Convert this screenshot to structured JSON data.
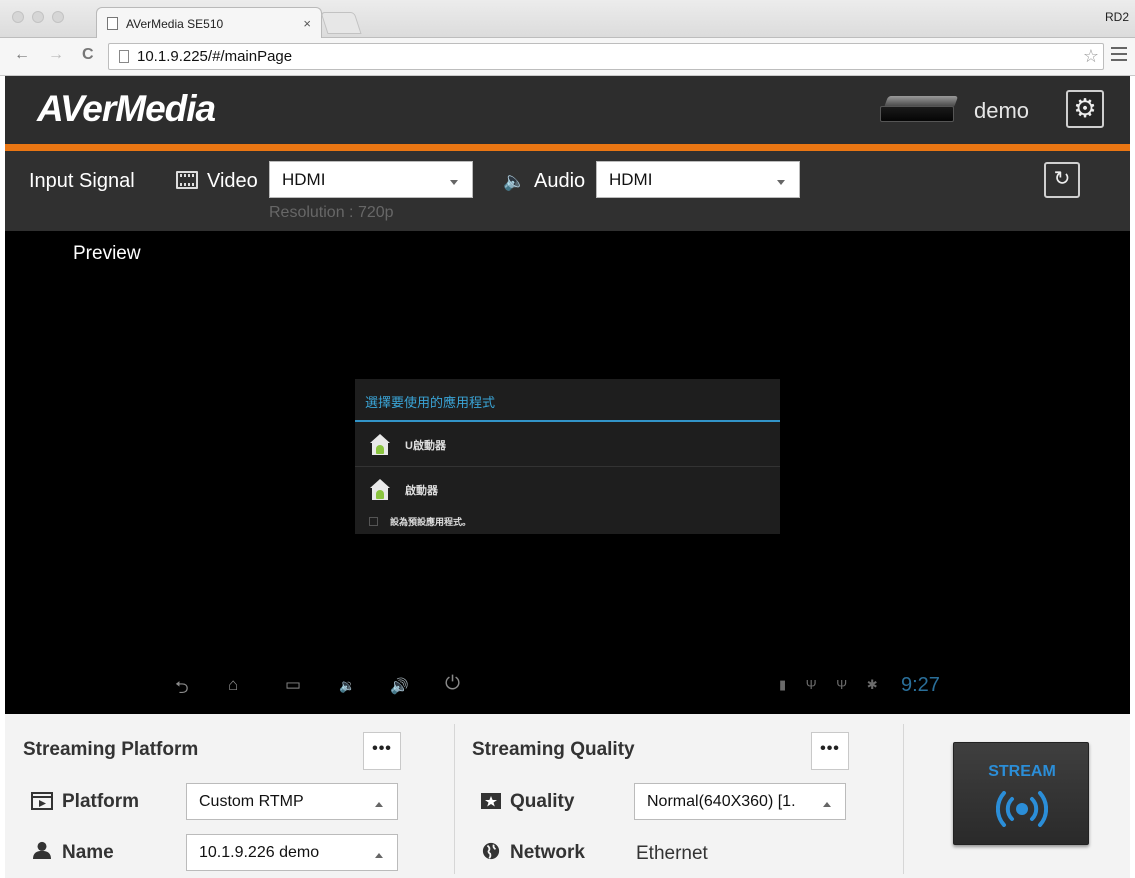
{
  "browser": {
    "tab_title": "AVerMedia SE510",
    "tab_close": "×",
    "profile": "RD2",
    "url": "10.1.9.225/#/mainPage",
    "back": "←",
    "forward": "→",
    "reload": "C",
    "bookmark_star": "☆"
  },
  "header": {
    "logo": "AVerMedia",
    "user": "demo",
    "settings_glyph": "⚙"
  },
  "input_signal": {
    "label": "Input Signal",
    "video_label": "Video",
    "video_value": "HDMI",
    "resolution": "Resolution : 720p",
    "audio_label": "Audio",
    "audio_value": "HDMI",
    "speaker_glyph": "🔈",
    "refresh_glyph": "↻"
  },
  "preview": {
    "label": "Preview",
    "dialog": {
      "title": "選擇要使用的應用程式",
      "items": [
        "U啟動器",
        "啟動器"
      ],
      "default_checkbox": "設為預設應用程式。"
    },
    "android_nav": [
      "⮌",
      "⌂",
      "▭",
      "🔉",
      "🔊",
      "⏻"
    ],
    "status_icons": "▮ Ψ Ψ ✱",
    "clock": "9:27"
  },
  "streaming_platform": {
    "title": "Streaming Platform",
    "more": "•••",
    "platform_label": "Platform",
    "platform_value": "Custom RTMP",
    "name_label": "Name",
    "name_value": "10.1.9.226 demo"
  },
  "streaming_quality": {
    "title": "Streaming Quality",
    "more": "•••",
    "quality_label": "Quality",
    "quality_value": "Normal(640X360) [1.",
    "network_label": "Network",
    "network_value": "Ethernet"
  },
  "stream_button": {
    "label": "STREAM"
  },
  "colors": {
    "accent_orange": "#ea7613",
    "header_bg": "#2d2d2d",
    "stream_blue": "#2b8ed8"
  }
}
